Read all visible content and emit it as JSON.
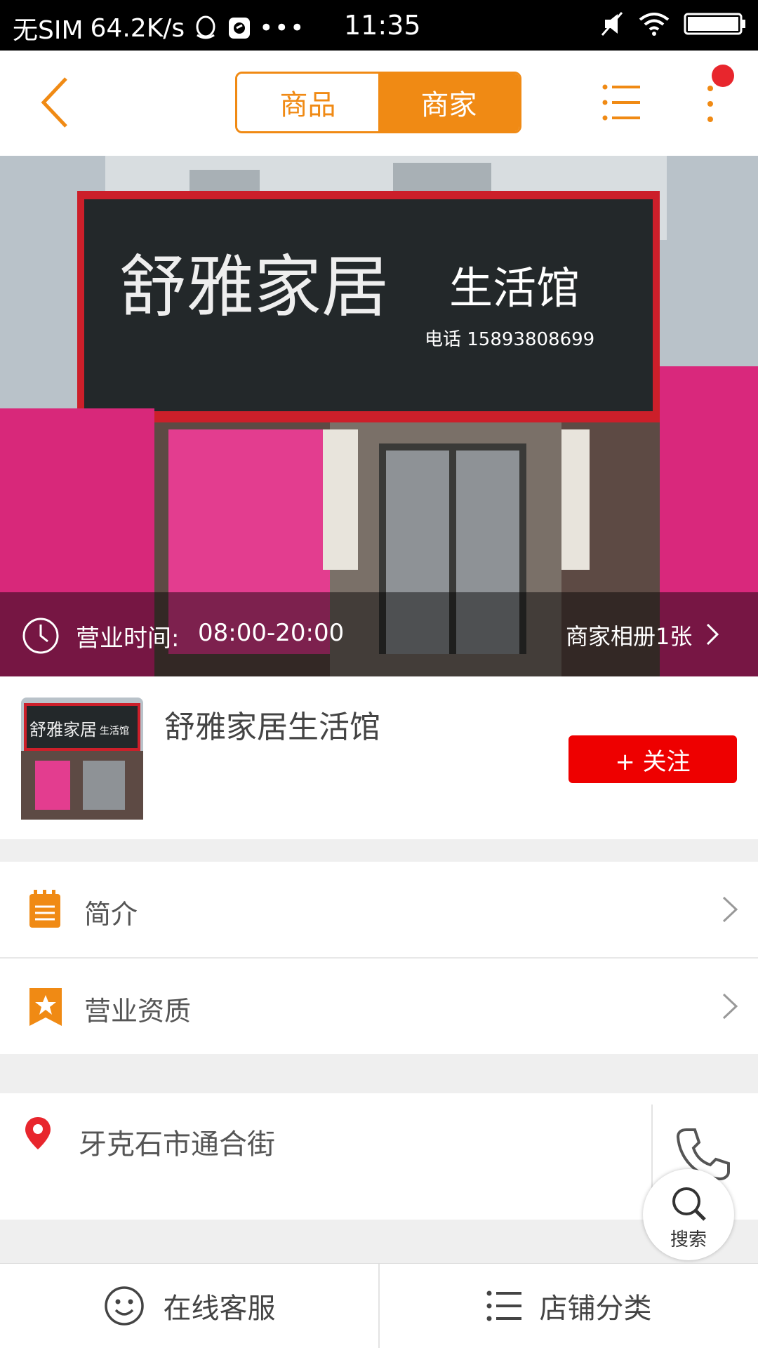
{
  "status_bar": {
    "carrier": "无SIM",
    "speed": "64.2K/s",
    "time": "11:35",
    "icons": [
      "qq-icon",
      "app-icon",
      "more-dots-icon",
      "mute-icon",
      "wifi-icon",
      "battery-icon"
    ]
  },
  "nav": {
    "back_icon": "chevron-left-icon",
    "tabs": [
      {
        "label": "商品",
        "active": false
      },
      {
        "label": "商家",
        "active": true
      }
    ],
    "list_icon": "list-icon",
    "more_icon": "more-vertical-icon",
    "accent": "#f08a14",
    "badge_color": "#e8262d"
  },
  "banner": {
    "sign_text": "舒雅家居",
    "sign_sub": "生活馆",
    "sign_phone": "电话 15893808699",
    "hours_label": "营业时间:",
    "hours_value": "08:00-20:00",
    "album_label": "商家相册1张"
  },
  "store": {
    "name": "舒雅家居生活馆",
    "follow_label": "+ 关注",
    "thumb_sign": "舒雅家居",
    "thumb_sign_sub": "生活馆",
    "follow_color": "#ee0000"
  },
  "menu": {
    "intro_label": "简介",
    "license_label": "营业资质"
  },
  "address": {
    "text": "牙克石市通合街"
  },
  "search": {
    "label": "搜索"
  },
  "bottom": {
    "service_label": "在线客服",
    "category_label": "店铺分类"
  }
}
